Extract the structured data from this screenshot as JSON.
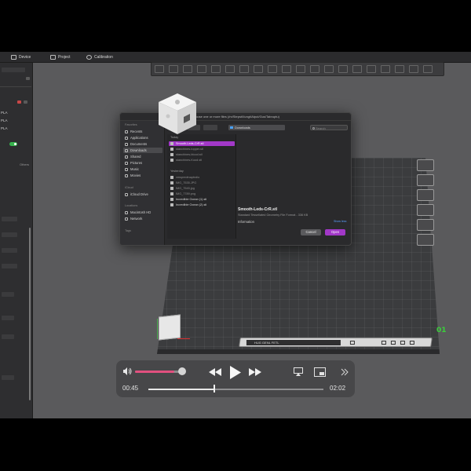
{
  "app": {
    "tabs": [
      {
        "label": "Device"
      },
      {
        "label": "Project"
      },
      {
        "label": "Calibration"
      }
    ],
    "left_panel": {
      "rows": [
        "PLA",
        "PLA",
        "PLA"
      ],
      "subheader": "Others"
    },
    "plate_label": "01",
    "statusbar_text": "HUG GENL FETL"
  },
  "dialog": {
    "title": "Choose one or more files (/m/Stepst/l/ungt/Atput/Gus/Tabruptu)",
    "sidebar": {
      "favorites_header": "Favorites",
      "favorites": [
        "Recents",
        "Applications",
        "Documents",
        "Downloads",
        "Shared",
        "Pictures",
        "Music",
        "Movies"
      ],
      "selected": "Downloads",
      "icloud_header": "iCloud",
      "icloud": [
        "iCloud Drive"
      ],
      "locations_header": "Locations",
      "locations": [
        "Macintosh HD",
        "Network"
      ],
      "tags_header": "Tags"
    },
    "location": "Downloads",
    "search_placeholder": "Search",
    "file_list": {
      "today_header": "Today",
      "today": [
        "Smooth-Leds-CrR.stl",
        "stanchines-topper.stl",
        "stanchines-blood.stl",
        "stanchines-Kood.stl"
      ],
      "yesterday_header": "Yesterday",
      "yesterday": [
        "xmspredmaptndio",
        "IMG_7535.JPG",
        "IMG_7545.jpg",
        "IMG_7789.png",
        "Incredible Ocean (1).stl",
        "Incredible Ocean (2).stl"
      ]
    },
    "preview": {
      "name": "Smooth-Leds-CrR.stl",
      "kind": "Standard Tessellated Geometry File Format - 336 KB",
      "info_label": "Information",
      "more_link": "Show less"
    },
    "cancel_label": "Cancel",
    "open_label": "Open"
  },
  "player": {
    "current_time": "00:45",
    "total_time": "02:02",
    "volume": 0.85,
    "progress": 0.37,
    "accent": "#e2507f"
  },
  "colors": {
    "accent_purple": "#a238c8",
    "plate_green": "#3ad13a"
  }
}
